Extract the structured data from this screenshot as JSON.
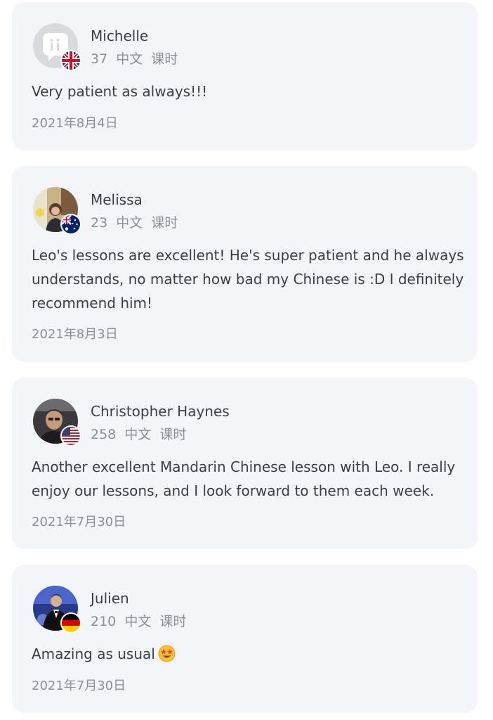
{
  "reviews": [
    {
      "name": "Michelle",
      "lessons_count": "37",
      "lessons_lang": "中文",
      "lessons_unit": "课时",
      "text": "Very patient as always!!!",
      "date": "2021年8月4日",
      "avatar": "placeholder-avatar",
      "flag": "united-kingdom-flag-icon"
    },
    {
      "name": "Melissa",
      "lessons_count": "23",
      "lessons_lang": "中文",
      "lessons_unit": "课时",
      "text": "Leo's lessons are excellent! He's super patient and he always understands, no matter how bad my Chinese is :D I definitely recommend him!",
      "date": "2021年8月3日",
      "avatar": "photo-avatar",
      "flag": "australia-flag-icon"
    },
    {
      "name": "Christopher Haynes",
      "lessons_count": "258",
      "lessons_lang": "中文",
      "lessons_unit": "课时",
      "text": "Another excellent Mandarin Chinese lesson with Leo. I really enjoy our lessons, and I look forward to them each week.",
      "date": "2021年7月30日",
      "avatar": "photo-avatar",
      "flag": "united-states-flag-icon"
    },
    {
      "name": "Julien",
      "lessons_count": "210",
      "lessons_lang": "中文",
      "lessons_unit": "课时",
      "text": "Amazing as usual",
      "emoji": "star-struck-emoji-icon",
      "date": "2021年7月30日",
      "avatar": "photo-avatar",
      "flag": "germany-flag-icon"
    }
  ],
  "colors": {
    "card_background": "#f4f5f9",
    "primary_text": "#384047",
    "secondary_text": "#8a8f98"
  }
}
